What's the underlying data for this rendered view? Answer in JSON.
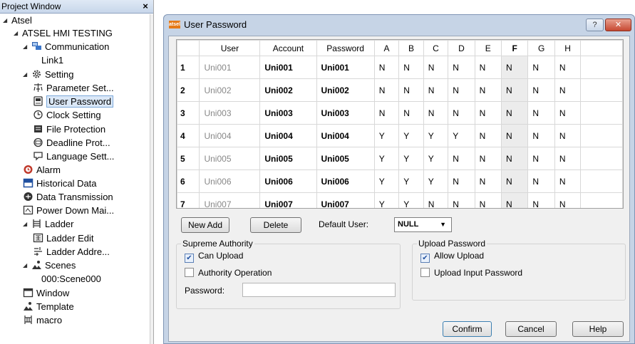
{
  "project_window": {
    "title": "Project Window",
    "close_label": "×",
    "tree": [
      {
        "id": "atsel",
        "label": "Atsel",
        "icon": "none",
        "toggle": "◢"
      },
      {
        "id": "project",
        "label": "ATSEL HMI TESTING",
        "icon": "none",
        "toggle": "◢"
      },
      {
        "id": "communication",
        "label": "Communication",
        "icon": "network-icon",
        "toggle": "◢"
      },
      {
        "id": "link1",
        "label": "Link1",
        "icon": "none",
        "toggle": ""
      },
      {
        "id": "setting",
        "label": "Setting",
        "icon": "gear-icon",
        "toggle": "◢"
      },
      {
        "id": "parameter",
        "label": "Parameter Set...",
        "icon": "parameter-icon",
        "toggle": ""
      },
      {
        "id": "user-password",
        "label": "User Password",
        "icon": "password-icon",
        "toggle": ""
      },
      {
        "id": "clock",
        "label": "Clock Setting",
        "icon": "clock-icon",
        "toggle": ""
      },
      {
        "id": "file-protection",
        "label": "File Protection",
        "icon": "file-protection-icon",
        "toggle": ""
      },
      {
        "id": "deadline",
        "label": "Deadline Prot...",
        "icon": "deadline-icon",
        "toggle": ""
      },
      {
        "id": "language",
        "label": "Language Sett...",
        "icon": "language-icon",
        "toggle": ""
      },
      {
        "id": "alarm",
        "label": "Alarm",
        "icon": "alarm-icon",
        "toggle": ""
      },
      {
        "id": "historical",
        "label": "Historical Data",
        "icon": "historical-data-icon",
        "toggle": ""
      },
      {
        "id": "data-transmission",
        "label": "Data Transmission",
        "icon": "data-transmission-icon",
        "toggle": ""
      },
      {
        "id": "power-down",
        "label": "Power Down Mai...",
        "icon": "power-down-icon",
        "toggle": ""
      },
      {
        "id": "ladder",
        "label": "Ladder",
        "icon": "ladder-icon",
        "toggle": "◢"
      },
      {
        "id": "ladder-edit",
        "label": "Ladder Edit",
        "icon": "ladder-edit-icon",
        "toggle": ""
      },
      {
        "id": "ladder-address",
        "label": "Ladder Addre...",
        "icon": "ladder-address-icon",
        "toggle": ""
      },
      {
        "id": "scenes",
        "label": "Scenes",
        "icon": "scenes-icon",
        "toggle": "◢"
      },
      {
        "id": "scene000",
        "label": "000:Scene000",
        "icon": "none",
        "toggle": ""
      },
      {
        "id": "window",
        "label": "Window",
        "icon": "window-icon",
        "toggle": ""
      },
      {
        "id": "template",
        "label": "Template",
        "icon": "template-icon",
        "toggle": ""
      },
      {
        "id": "macro",
        "label": "macro",
        "icon": "macro-icon",
        "toggle": ""
      }
    ]
  },
  "dialog": {
    "logo_text": "atsel",
    "title": "User Password",
    "help_label": "?",
    "close_label": "✕",
    "table": {
      "headers": [
        "",
        "User",
        "Account",
        "Password",
        "A",
        "B",
        "C",
        "D",
        "E",
        "F",
        "G",
        "H",
        ""
      ],
      "rows": [
        [
          "1",
          "Uni001",
          "Uni001",
          "Uni001",
          "N",
          "N",
          "N",
          "N",
          "N",
          "N",
          "N",
          "N"
        ],
        [
          "2",
          "Uni002",
          "Uni002",
          "Uni002",
          "N",
          "N",
          "N",
          "N",
          "N",
          "N",
          "N",
          "N"
        ],
        [
          "3",
          "Uni003",
          "Uni003",
          "Uni003",
          "N",
          "N",
          "N",
          "N",
          "N",
          "N",
          "N",
          "N"
        ],
        [
          "4",
          "Uni004",
          "Uni004",
          "Uni004",
          "Y",
          "Y",
          "Y",
          "Y",
          "N",
          "N",
          "N",
          "N"
        ],
        [
          "5",
          "Uni005",
          "Uni005",
          "Uni005",
          "Y",
          "Y",
          "Y",
          "N",
          "N",
          "N",
          "N",
          "N"
        ],
        [
          "6",
          "Uni006",
          "Uni006",
          "Uni006",
          "Y",
          "Y",
          "Y",
          "N",
          "N",
          "N",
          "N",
          "N"
        ],
        [
          "7",
          "Uni007",
          "Uni007",
          "Uni007",
          "Y",
          "Y",
          "N",
          "N",
          "N",
          "N",
          "N",
          "N"
        ]
      ]
    },
    "new_add_label": "New Add",
    "delete_label": "Delete",
    "default_user_label": "Default User:",
    "default_user_value": "NULL",
    "supreme": {
      "title": "Supreme Authority",
      "can_upload_label": "Can Upload",
      "can_upload_checked": true,
      "authority_operation_label": "Authority Operation",
      "authority_operation_checked": false,
      "password_label": "Password:",
      "password_value": ""
    },
    "upload": {
      "title": "Upload Password",
      "allow_upload_label": "Allow Upload",
      "allow_upload_checked": true,
      "upload_input_label": "Upload Input Password",
      "upload_input_checked": false
    },
    "confirm_label": "Confirm",
    "cancel_label": "Cancel",
    "help_button_label": "Help"
  }
}
